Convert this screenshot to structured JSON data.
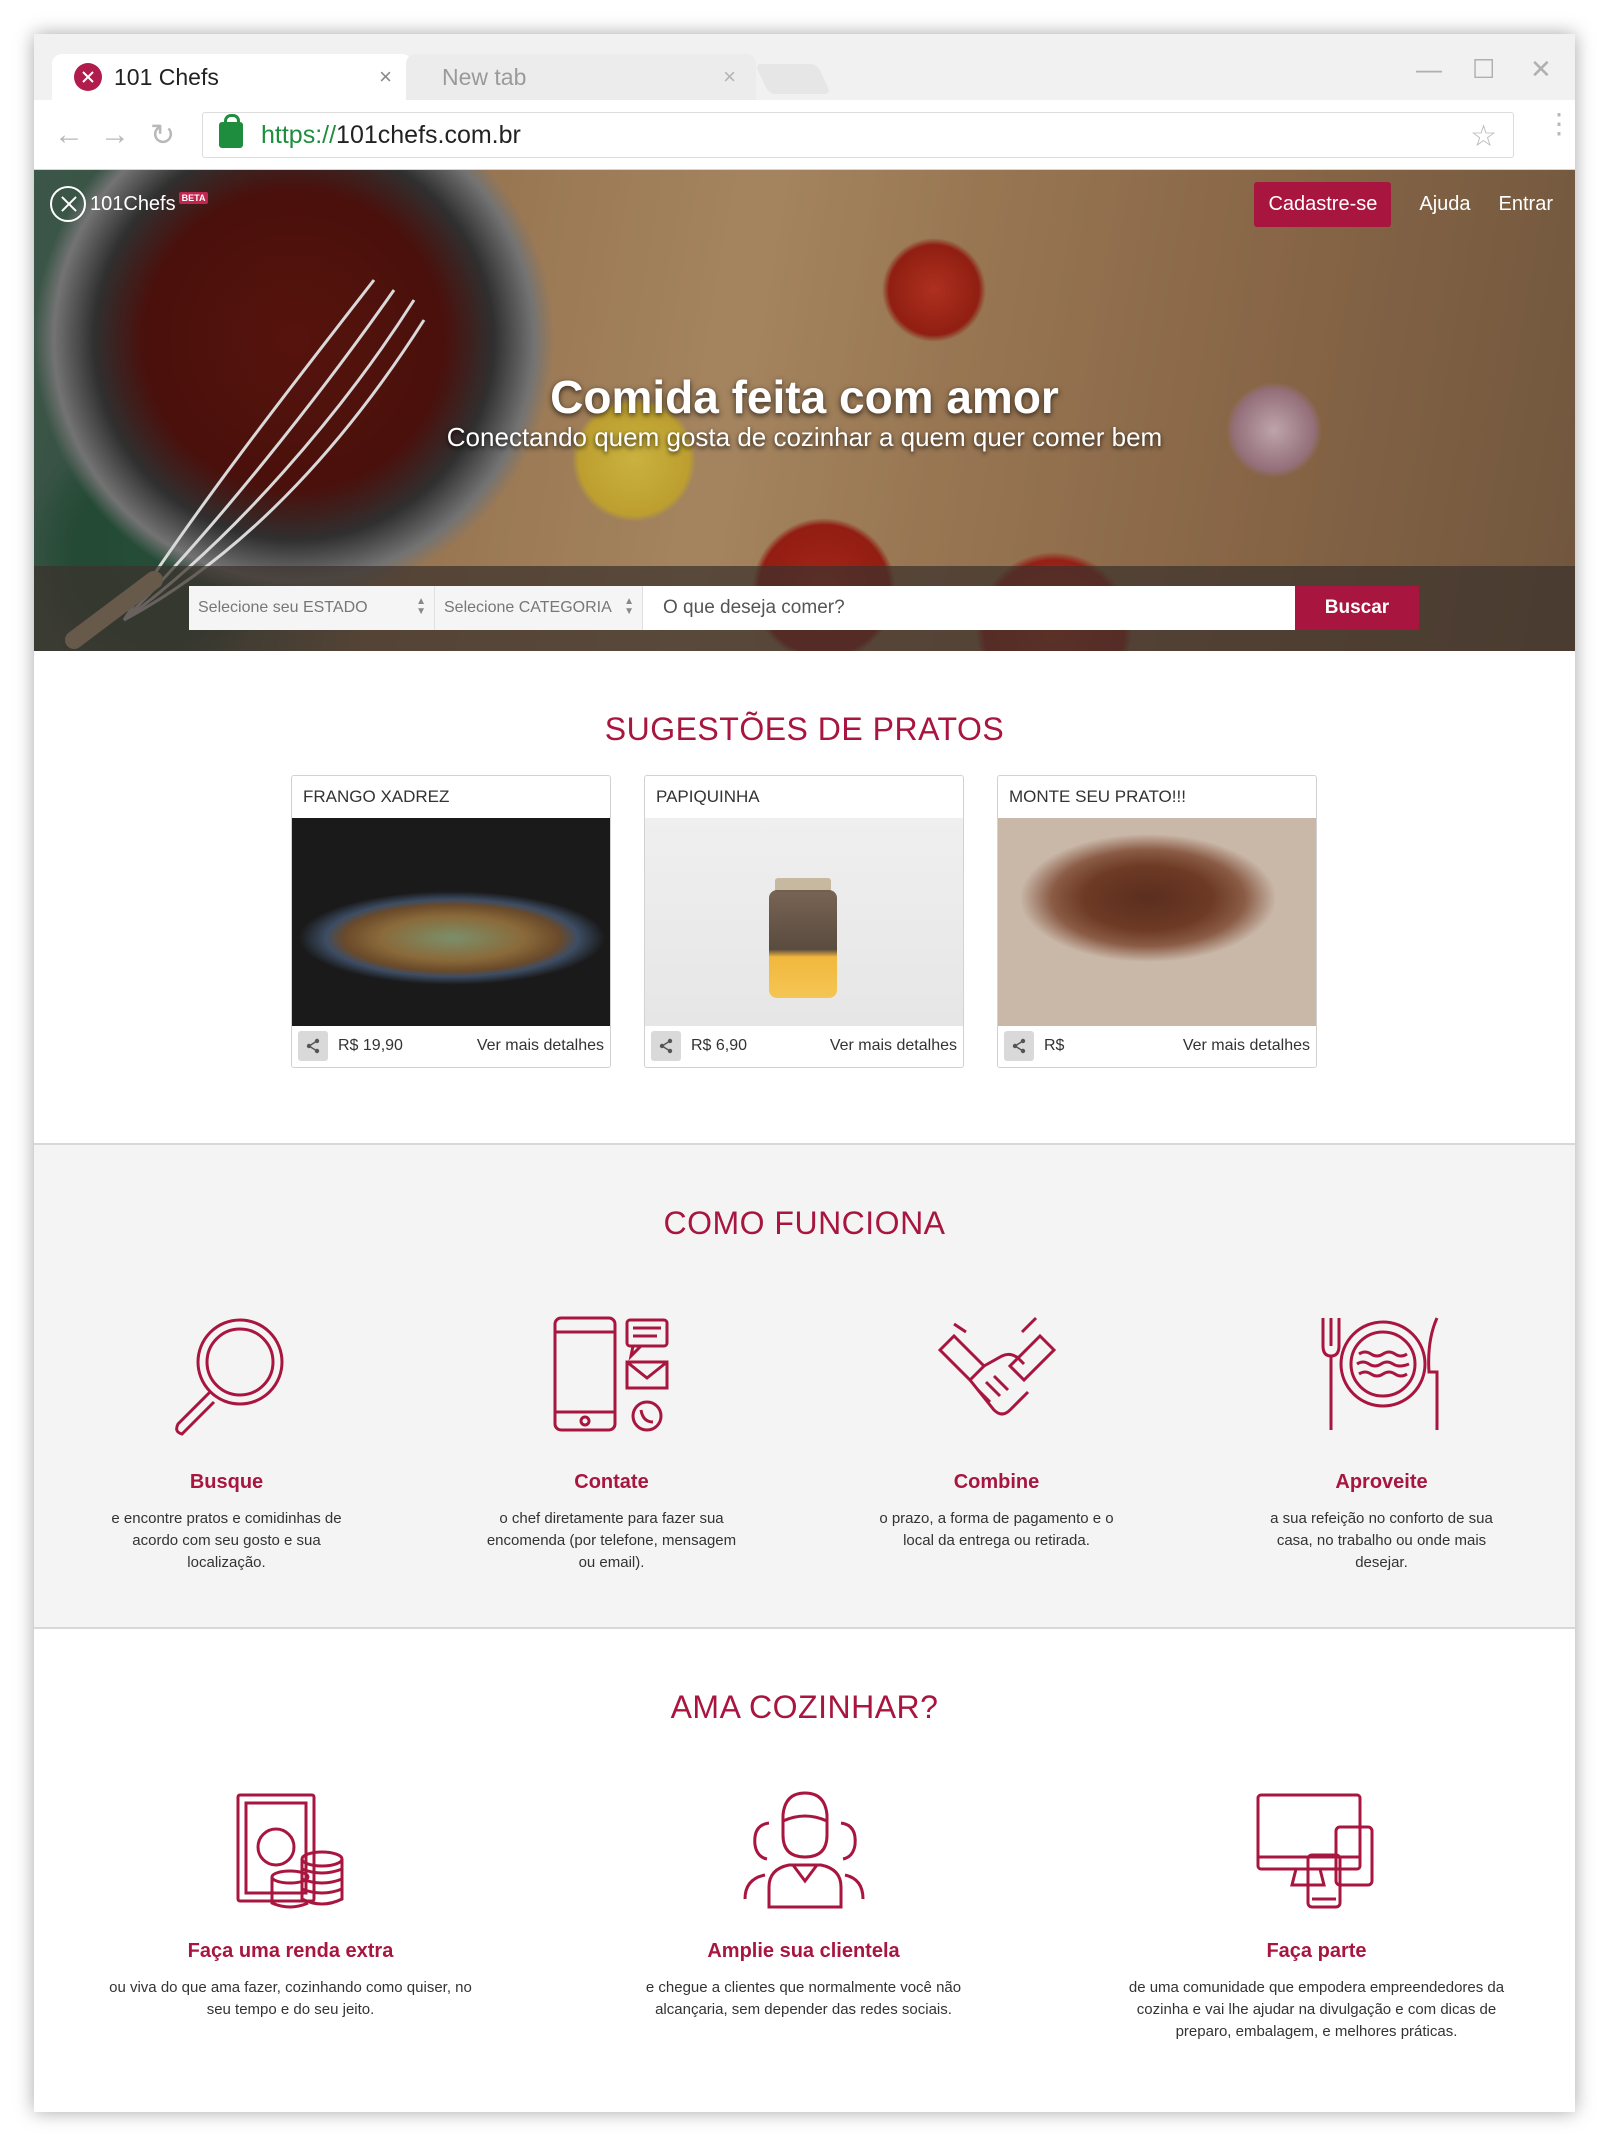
{
  "browser": {
    "tabs": [
      {
        "title": "101 Chefs",
        "active": true
      },
      {
        "title": "New tab",
        "active": false
      }
    ],
    "close_glyph": "×",
    "url_scheme": "https://",
    "url_host": "101chefs.com.br"
  },
  "header": {
    "logo_text": "101Chefs",
    "beta_badge": "BETA",
    "nav": {
      "signup": "Cadastre-se",
      "help": "Ajuda",
      "login": "Entrar"
    }
  },
  "hero": {
    "title": "Comida feita com amor",
    "subtitle": "Conectando quem gosta de cozinhar a quem quer comer bem"
  },
  "search": {
    "state_select": "Selecione seu ESTADO",
    "category_select": "Selecione CATEGORIA",
    "placeholder": "O que deseja comer?",
    "button": "Buscar"
  },
  "suggestions": {
    "title": "SUGESTÕES DE PRATOS",
    "cards": [
      {
        "name": "FRANGO XADREZ",
        "price": "R$ 19,90",
        "more": "Ver mais detalhes"
      },
      {
        "name": "PAPIQUINHA",
        "price": "R$ 6,90",
        "more": "Ver mais detalhes"
      },
      {
        "name": "MONTE SEU PRATO!!!",
        "price": "R$",
        "more": "Ver mais detalhes"
      }
    ]
  },
  "how_it_works": {
    "title": "COMO FUNCIONA",
    "steps": [
      {
        "name": "Busque",
        "desc": "e encontre pratos e comidinhas de acordo com seu gosto e sua localização.",
        "icon": "magnifier-icon"
      },
      {
        "name": "Contate",
        "desc": "o chef diretamente para fazer sua encomenda (por telefone, mensagem ou email).",
        "icon": "phone-contact-icon"
      },
      {
        "name": "Combine",
        "desc": "o prazo, a forma de pagamento e o local da entrega ou retirada.",
        "icon": "handshake-icon"
      },
      {
        "name": "Aproveite",
        "desc": "a sua refeição no conforto de sua casa, no trabalho ou onde mais desejar.",
        "icon": "plate-cutlery-icon"
      }
    ]
  },
  "love_cooking": {
    "title": "AMA COZINHAR?",
    "items": [
      {
        "name": "Faça uma renda extra",
        "desc": "ou viva do que ama fazer, cozinhando como quiser, no seu tempo e do seu jeito.",
        "icon": "money-coins-icon"
      },
      {
        "name": "Amplie sua clientela",
        "desc": "e chegue a clientes que normalmente você não alcançaria, sem depender das redes sociais.",
        "icon": "people-group-icon"
      },
      {
        "name": "Faça parte",
        "desc": "de uma comunidade que empodera empreendedores da cozinha e vai lhe ajudar na divulgação e com dicas de preparo, embalagem, e melhores práticas.",
        "icon": "devices-icon"
      }
    ]
  },
  "colors": {
    "brand": "#a8163f",
    "tab_strip": "#f1f1f1",
    "section_gray": "#f4f4f4"
  }
}
